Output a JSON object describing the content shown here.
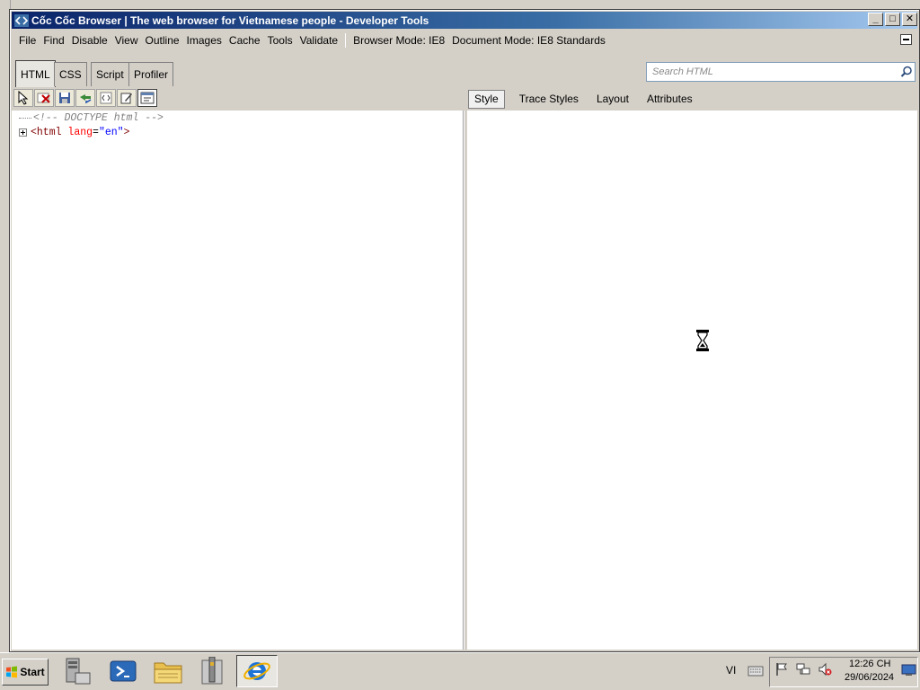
{
  "window": {
    "title": "Cốc Cốc Browser | The web browser for Vietnamese people - Developer Tools",
    "buttons": {
      "minimize": "_",
      "maximize": "□",
      "close": "✕"
    }
  },
  "menu": {
    "items": [
      "File",
      "Find",
      "Disable",
      "View",
      "Outline",
      "Images",
      "Cache",
      "Tools",
      "Validate"
    ],
    "browser_mode": "Browser Mode: IE8",
    "document_mode": "Document Mode: IE8 Standards"
  },
  "tabs": [
    "HTML",
    "CSS",
    "Script",
    "Profiler"
  ],
  "active_tab": "HTML",
  "search": {
    "placeholder": "Search HTML",
    "value": ""
  },
  "toolbar_icons": [
    "select-element-icon",
    "clear-icon",
    "save-icon",
    "refresh-icon",
    "word-wrap-icon",
    "edit-icon",
    "view-source-icon"
  ],
  "right_tabs": [
    "Style",
    "Trace Styles",
    "Layout",
    "Attributes"
  ],
  "active_right_tab": "Style",
  "tree": {
    "doctype": "<!-- DOCTYPE html -->",
    "html_open": "<html",
    "html_attr_name": "lang",
    "html_attr_eq": "=",
    "html_attr_value": "\"en\"",
    "html_close": ">"
  },
  "taskbar": {
    "start_label": "Start",
    "language": "VI",
    "time": "12:26 CH",
    "date": "29/06/2024"
  },
  "colors": {
    "title_gradient_start": "#0a246a",
    "title_gradient_end": "#a6caf0",
    "tag": "#800000",
    "attr": "#ff0000",
    "value": "#0000ff"
  }
}
